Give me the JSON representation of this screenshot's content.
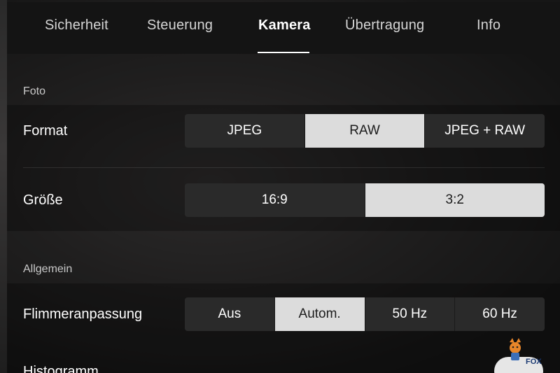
{
  "tabs": [
    {
      "label": "Sicherheit",
      "active": false
    },
    {
      "label": "Steuerung",
      "active": false
    },
    {
      "label": "Kamera",
      "active": true
    },
    {
      "label": "Übertragung",
      "active": false
    },
    {
      "label": "Info",
      "active": false
    }
  ],
  "sections": {
    "foto": "Foto",
    "allgemein": "Allgemein"
  },
  "rows": {
    "format": {
      "label": "Format",
      "options": [
        "JPEG",
        "RAW",
        "JPEG + RAW"
      ],
      "selected": "RAW"
    },
    "groesse": {
      "label": "Größe",
      "options": [
        "16:9",
        "3:2"
      ],
      "selected": "3:2"
    },
    "flimmer": {
      "label": "Flimmeranpassung",
      "options": [
        "Aus",
        "Autom.",
        "50 Hz",
        "60 Hz"
      ],
      "selected": "Autom."
    },
    "histogramm": {
      "label": "Histogramm",
      "toggle_on": true
    }
  },
  "watermark": {
    "text": "FOX"
  },
  "colors": {
    "selected_bg": "#dcdcdc",
    "segment_bg": "#2a2a2a",
    "tab_bar_bg": "#141414"
  }
}
